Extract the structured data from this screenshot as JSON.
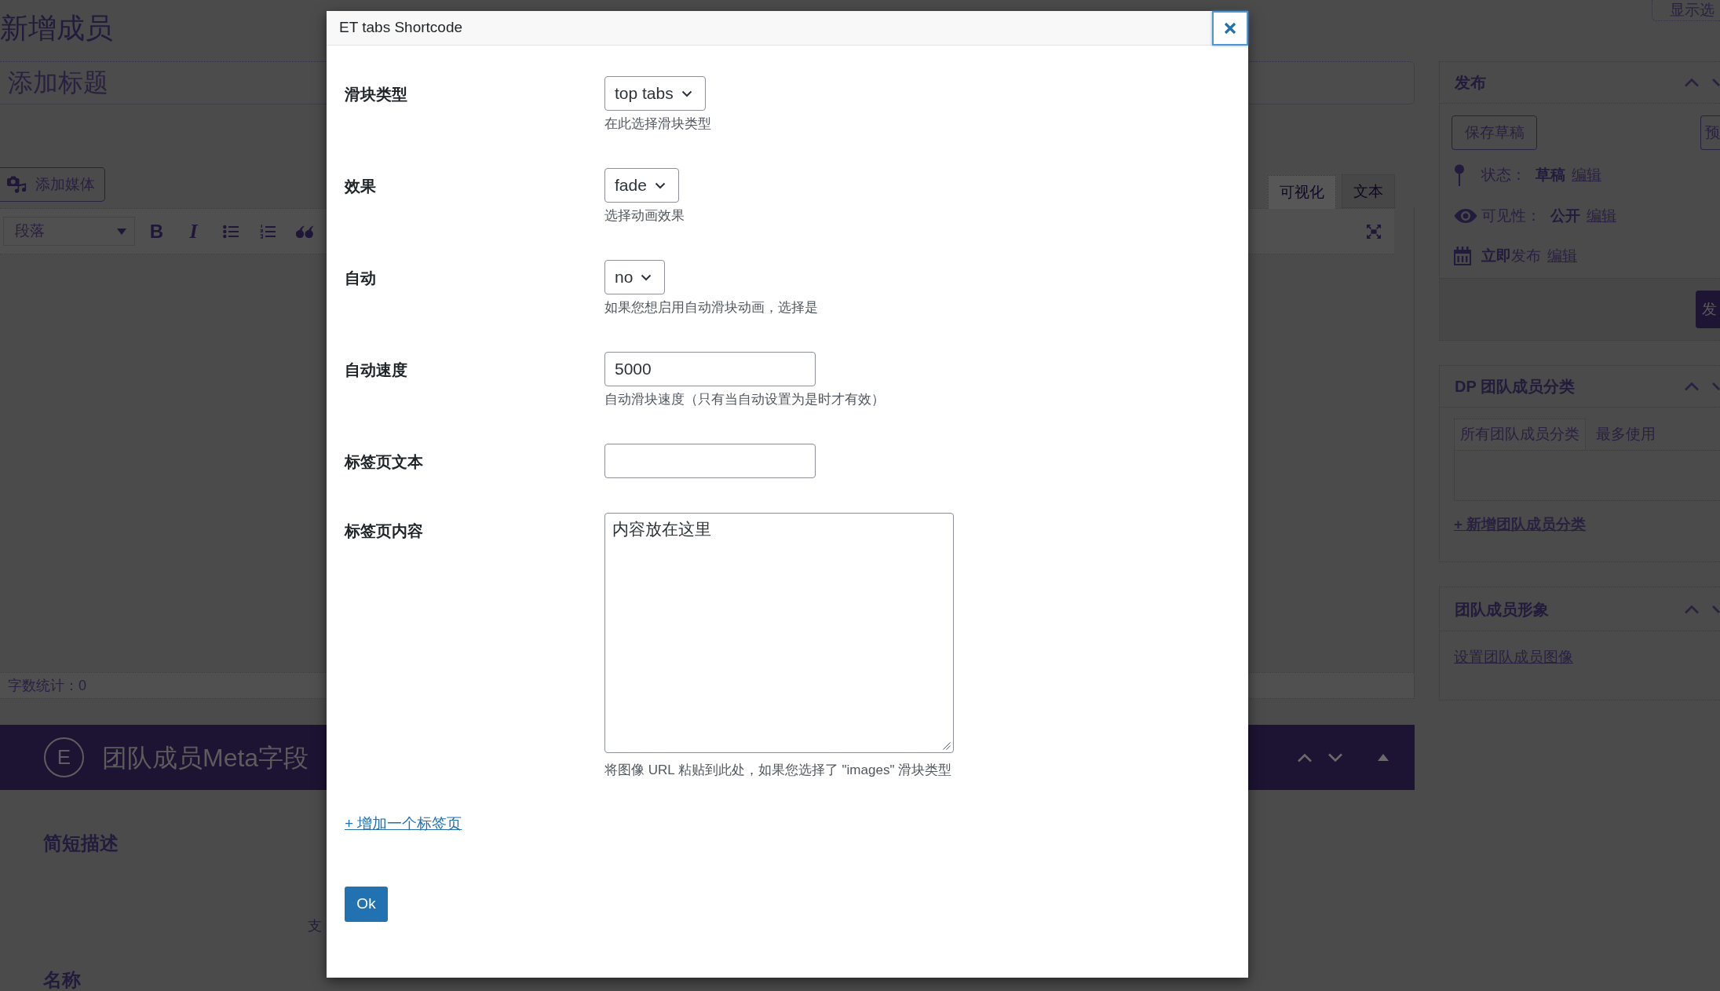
{
  "page": {
    "heading": "新增成员",
    "screen_options": "显示选",
    "title_placeholder": "添加标题"
  },
  "editor": {
    "add_media": "添加媒体",
    "format": "段落",
    "tools": [
      {
        "kind": "bold",
        "glyph": "B"
      },
      {
        "kind": "italic",
        "glyph": "I"
      },
      {
        "kind": "bullets"
      },
      {
        "kind": "numbers"
      },
      {
        "kind": "quote"
      }
    ],
    "tabs": [
      {
        "label": "可视化",
        "selected": true
      },
      {
        "label": "文本",
        "selected": false
      }
    ],
    "word_count": "字数统计：0"
  },
  "meta_box": {
    "logo": "E",
    "title": "团队成员Meta字段",
    "fields": [
      {
        "label": "简短描述",
        "note": "支"
      },
      {
        "label": "名称"
      }
    ]
  },
  "sidebar": {
    "publish": {
      "title": "发布",
      "save_draft": "保存草稿",
      "preview": "预",
      "rows": [
        {
          "kind": "status",
          "label": "状态：",
          "value": "草稿",
          "link": "编辑"
        },
        {
          "kind": "visibility",
          "label": "可见性：",
          "value": "公开",
          "link": "编辑"
        },
        {
          "kind": "schedule",
          "text": "**立即**发布",
          "link": "编辑"
        }
      ],
      "publish_button": "发"
    },
    "categories": {
      "title": "DP 团队成员分类",
      "tabs": [
        {
          "label": "所有团队成员分类",
          "selected": true
        },
        {
          "label": "最多使用",
          "selected": false
        }
      ],
      "add_link": "+ 新增团队成员分类"
    },
    "image": {
      "title": "团队成员形象",
      "link": "设置团队成员图像"
    }
  },
  "dialog": {
    "title": "ET tabs Shortcode",
    "fields": [
      {
        "kind": "select",
        "label": "滑块类型",
        "value": "top tabs",
        "help": "在此选择滑块类型"
      },
      {
        "kind": "select",
        "label": "效果",
        "value": "fade",
        "help": "选择动画效果"
      },
      {
        "kind": "select",
        "label": "自动",
        "value": "no",
        "help": "如果您想启用自动滑块动画，选择是"
      },
      {
        "kind": "text",
        "label": "自动速度",
        "value": "5000",
        "help": "自动滑块速度（只有当自动设置为是时才有效）"
      },
      {
        "kind": "text",
        "label": "标签页文本"
      },
      {
        "kind": "textarea",
        "label": "标签页内容",
        "value": "内容放在这里",
        "help": "将图像 URL 粘贴到此处，如果您选择了 \"images\" 滑块类型"
      }
    ],
    "add_tab": "+ 增加一个标签页",
    "ok": "Ok"
  }
}
